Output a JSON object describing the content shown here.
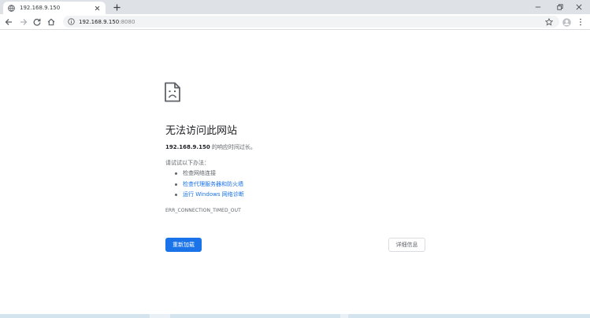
{
  "browser": {
    "tab": {
      "title": "192.168.9.150",
      "favicon": "globe-icon"
    },
    "new_tab_label": "+",
    "window_controls": [
      "minimize-icon",
      "restore-icon",
      "close-icon"
    ],
    "toolbar": {
      "url_host": "192.168.9.150",
      "url_port": ":8080",
      "icons": [
        "back-arrow-icon",
        "forward-arrow-icon",
        "reload-icon",
        "home-icon",
        "info-icon",
        "star-icon",
        "profile-icon",
        "more-menu-icon"
      ]
    }
  },
  "error_page": {
    "icon": "sad-document-icon",
    "title": "无法访问此网站",
    "host": "192.168.9.150",
    "host_suffix": " 的响应时间过长。",
    "try_label": "请试试以下办法：",
    "suggestions": [
      {
        "text": "检查网络连接",
        "link": false
      },
      {
        "text": "检查代理服务器和防火墙",
        "link": true
      },
      {
        "text": "运行 Windows 网络诊断",
        "link": true
      }
    ],
    "error_code": "ERR_CONNECTION_TIMED_OUT",
    "reload_button": "重新加载",
    "details_button": "详细信息"
  },
  "colors": {
    "tabstrip_bg": "#dee1e6",
    "link": "#1a73e8",
    "primary_button": "#1a73e8",
    "text_secondary": "#5f6368"
  }
}
